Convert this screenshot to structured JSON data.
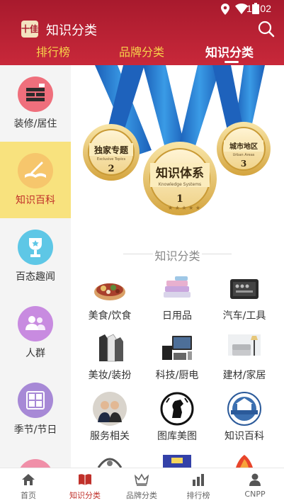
{
  "status_bar": {
    "time": "10:02"
  },
  "header": {
    "logo_text": "十佳",
    "title": "知识分类",
    "tabs": [
      {
        "label": "排行榜"
      },
      {
        "label": "品牌分类"
      },
      {
        "label": "知识分类"
      }
    ],
    "active_tab": 2
  },
  "sidebar": {
    "items": [
      {
        "label": "装修/居住",
        "icon": "brick-wall-icon",
        "color": "#ef6f7c"
      },
      {
        "label": "知识百科",
        "icon": "open-book-icon",
        "color": "#f6c66c"
      },
      {
        "label": "百态趣闻",
        "icon": "trophy-icon",
        "color": "#5ec7e6"
      },
      {
        "label": "人群",
        "icon": "people-icon",
        "color": "#c88be0"
      },
      {
        "label": "季节/节日",
        "icon": "calendar-icon",
        "color": "#a789d6"
      },
      {
        "label": "",
        "icon": "partial-icon",
        "color": "#f08fa8"
      }
    ],
    "active_index": 1
  },
  "banner": {
    "medals": [
      {
        "title": "独家专题",
        "subtitle": "Exclusive Topics",
        "number": "2"
      },
      {
        "title": "知识体系",
        "subtitle": "Knowledge Systems",
        "number": "1"
      },
      {
        "title": "城市地区",
        "subtitle": "Urban Areas",
        "number": "3"
      }
    ]
  },
  "section": {
    "title": "知识分类"
  },
  "categories": [
    {
      "label": "美食/饮食",
      "icon": "food-icon"
    },
    {
      "label": "日用品",
      "icon": "towels-icon"
    },
    {
      "label": "汽车/工具",
      "icon": "toolbox-icon"
    },
    {
      "label": "美妆/装扮",
      "icon": "clothes-icon"
    },
    {
      "label": "科技/厨电",
      "icon": "electronics-icon"
    },
    {
      "label": "建材/家居",
      "icon": "furniture-icon"
    },
    {
      "label": "服务相关",
      "icon": "service-people-icon"
    },
    {
      "label": "图库美图",
      "icon": "horse-emblem-icon"
    },
    {
      "label": "知识百科",
      "icon": "building-emblem-icon"
    }
  ],
  "bottom_nav": {
    "items": [
      {
        "label": "首页",
        "icon": "home-icon"
      },
      {
        "label": "知识分类",
        "icon": "book-icon"
      },
      {
        "label": "品牌分类",
        "icon": "crown-icon"
      },
      {
        "label": "排行榜",
        "icon": "bar-chart-icon"
      },
      {
        "label": "CNPP",
        "icon": "person-icon"
      }
    ],
    "active_index": 1
  },
  "colors": {
    "header": "#b31f33",
    "accent": "#c0302a",
    "tab_inactive": "#f7d24a",
    "sidebar_active": "#f8e27e"
  }
}
